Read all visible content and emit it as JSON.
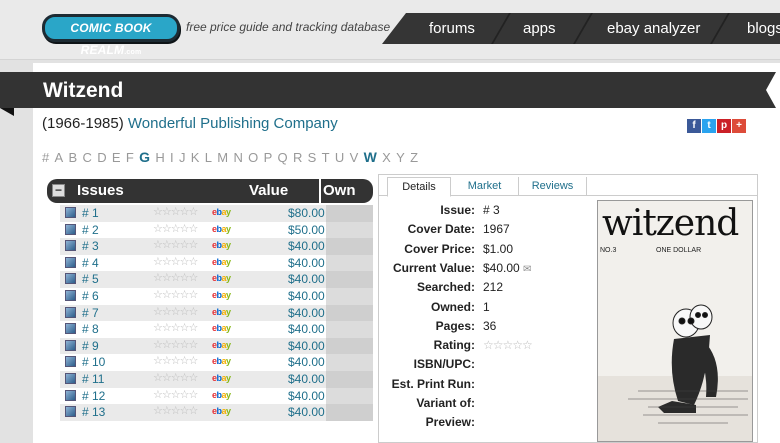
{
  "header": {
    "logo_text": "COMIC BOOK REALM",
    "logo_suffix": ".com",
    "tagline": "free price guide and tracking database",
    "nav": [
      "forums",
      "apps",
      "ebay analyzer",
      "blogs"
    ]
  },
  "page": {
    "title": "Witzend",
    "years": "(1966-1985)",
    "publisher": "Wonderful Publishing Company",
    "share_icons": [
      "f",
      "t",
      "p",
      "+"
    ],
    "share_colors": [
      "#3b5998",
      "#2aa3ef",
      "#cb2027",
      "#dd4b39"
    ],
    "letters": [
      "#",
      "A",
      "B",
      "C",
      "D",
      "E",
      "F",
      "G",
      "H",
      "I",
      "J",
      "K",
      "L",
      "M",
      "N",
      "O",
      "P",
      "Q",
      "R",
      "S",
      "T",
      "U",
      "V",
      "W",
      "X",
      "Y",
      "Z"
    ],
    "active_letters": [
      "G",
      "W"
    ]
  },
  "issues_table": {
    "headers": {
      "toggle": "−",
      "issues": "Issues",
      "value": "Value",
      "own": "Own"
    },
    "stars": "☆☆☆☆☆",
    "ebay": [
      "e",
      "b",
      "a",
      "y"
    ],
    "rows": [
      {
        "num": "# 1",
        "value": "$80.00"
      },
      {
        "num": "# 2",
        "value": "$50.00"
      },
      {
        "num": "# 3",
        "value": "$40.00"
      },
      {
        "num": "# 4",
        "value": "$40.00"
      },
      {
        "num": "# 5",
        "value": "$40.00"
      },
      {
        "num": "# 6",
        "value": "$40.00"
      },
      {
        "num": "# 7",
        "value": "$40.00"
      },
      {
        "num": "# 8",
        "value": "$40.00"
      },
      {
        "num": "# 9",
        "value": "$40.00"
      },
      {
        "num": "# 10",
        "value": "$40.00"
      },
      {
        "num": "# 11",
        "value": "$40.00"
      },
      {
        "num": "# 12",
        "value": "$40.00"
      },
      {
        "num": "# 13",
        "value": "$40.00"
      }
    ]
  },
  "details": {
    "tabs": [
      "Details",
      "Market",
      "Reviews"
    ],
    "active_tab": "Details",
    "fields": [
      {
        "label": "Issue:",
        "value": "# 3"
      },
      {
        "label": "Cover Date:",
        "value": "1967"
      },
      {
        "label": "Cover Price:",
        "value": "$1.00"
      },
      {
        "label": "Current Value:",
        "value": "$40.00"
      },
      {
        "label": "Searched:",
        "value": "212"
      },
      {
        "label": "Owned:",
        "value": "1"
      },
      {
        "label": "Pages:",
        "value": "36"
      },
      {
        "label": "Rating:",
        "value": "☆☆☆☆☆"
      },
      {
        "label": "ISBN/UPC:",
        "value": ""
      },
      {
        "label": "Est. Print Run:",
        "value": ""
      },
      {
        "label": "Variant of:",
        "value": ""
      },
      {
        "label": "Preview:",
        "value": ""
      }
    ],
    "cover": {
      "title": "witzend",
      "price": "ONE DOLLAR",
      "number": "NO.3"
    }
  }
}
